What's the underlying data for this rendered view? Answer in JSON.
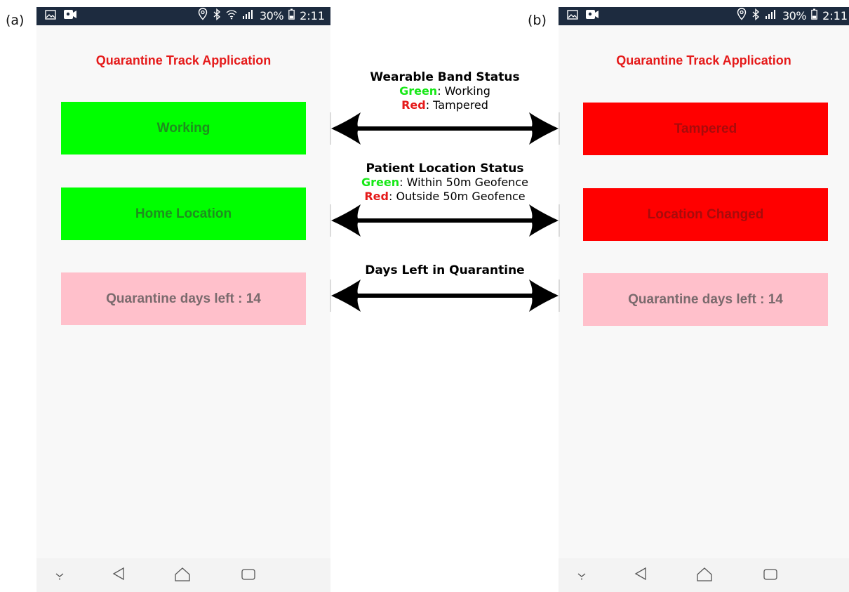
{
  "labels": {
    "a": "(a)",
    "b": "(b)"
  },
  "status_bar": {
    "battery": "30%",
    "time": "2:11",
    "icons_left": [
      "gallery-icon",
      "video-icon"
    ],
    "icons_right_a": [
      "location-pin-icon",
      "bluetooth-icon",
      "wifi-icon",
      "signal-icon",
      "battery-icon"
    ],
    "icons_right_b": [
      "location-pin-icon",
      "bluetooth-icon",
      "signal-icon",
      "battery-icon"
    ]
  },
  "app_title": "Quarantine Track Application",
  "phone_a": {
    "band_status": "Working",
    "location_status": "Home Location",
    "days_left": "Quarantine days left : 14"
  },
  "phone_b": {
    "band_status": "Tampered",
    "location_status": "Location Changed",
    "days_left": "Quarantine days left : 14"
  },
  "legend": {
    "band": {
      "title": "Wearable Band Status",
      "green_word": "Green",
      "green_text": ": Working",
      "red_word": "Red",
      "red_text": ": Tampered"
    },
    "location": {
      "title": "Patient Location Status",
      "green_word": "Green",
      "green_text": ": Within 50m Geofence",
      "red_word": "Red",
      "red_text": ": Outside 50m Geofence"
    },
    "days": {
      "title": "Days Left in Quarantine"
    }
  },
  "colors": {
    "ok": "#00ff00",
    "ok_text": "#1e8e1e",
    "alert": "#ff0000",
    "alert_text": "#a80b0b",
    "days_bg": "#ffc0cb",
    "days_text": "#7a6a6d",
    "title": "#e51a1a",
    "status_bar": "#1d2b3f"
  },
  "nav_icons": [
    "chevron-down-icon",
    "back-icon",
    "home-icon",
    "recents-icon"
  ]
}
